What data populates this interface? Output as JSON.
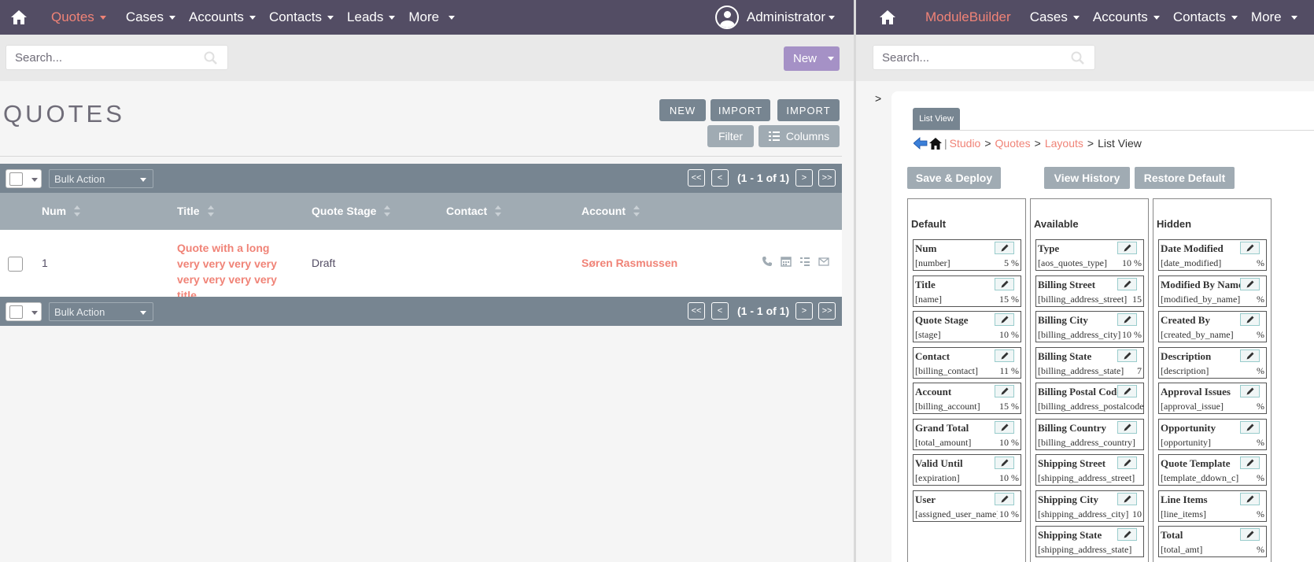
{
  "left": {
    "nav": {
      "items": [
        {
          "label": "Quotes"
        },
        {
          "label": "Cases"
        },
        {
          "label": "Accounts"
        },
        {
          "label": "Contacts"
        },
        {
          "label": "Leads"
        },
        {
          "label": "More"
        }
      ],
      "user": "Administrator"
    },
    "search": {
      "placeholder": "Search..."
    },
    "new_button": "New",
    "page_title": "QUOTES",
    "actions": {
      "new": "NEW",
      "import1": "IMPORT",
      "import2": "IMPORT",
      "filter": "Filter",
      "columns": "Columns"
    },
    "bulk_action": "Bulk Action",
    "pagination": {
      "first": "<<",
      "prev": "<",
      "range": "(1 - 1 of 1)",
      "next": ">",
      "last": ">>"
    },
    "table": {
      "columns": [
        "Num",
        "Title",
        "Quote Stage",
        "Contact",
        "Account"
      ],
      "rows": [
        {
          "num": "1",
          "title": "Quote with a long very very very very very very very very title",
          "stage": "Draft",
          "contact": "",
          "account": "Søren Rasmussen"
        }
      ]
    }
  },
  "right": {
    "nav": {
      "items": [
        {
          "label": "ModuleBuilder"
        },
        {
          "label": "Cases"
        },
        {
          "label": "Accounts"
        },
        {
          "label": "Contacts"
        },
        {
          "label": "More"
        }
      ]
    },
    "search": {
      "placeholder": "Search..."
    },
    "collapse": ">",
    "tab": "List View",
    "breadcrumb": {
      "sep": "|",
      "studio": "Studio",
      "module": "Quotes",
      "layouts": "Layouts",
      "current": "List View",
      "gt": ">"
    },
    "buttons": {
      "save": "Save & Deploy",
      "history": "View History",
      "restore": "Restore Default"
    },
    "columns": {
      "default": {
        "title": "Default",
        "fields": [
          {
            "name": "Num",
            "key": "[number]",
            "width": "5 %"
          },
          {
            "name": "Title",
            "key": "[name]",
            "width": "15 %"
          },
          {
            "name": "Quote Stage",
            "key": "[stage]",
            "width": "10 %"
          },
          {
            "name": "Contact",
            "key": "[billing_contact]",
            "width": "11 %"
          },
          {
            "name": "Account",
            "key": "[billing_account]",
            "width": "15 %"
          },
          {
            "name": "Grand Total",
            "key": "[total_amount]",
            "width": "10 %"
          },
          {
            "name": "Valid Until",
            "key": "[expiration]",
            "width": "10 %"
          },
          {
            "name": "User",
            "key": "[assigned_user_name]",
            "width": "10 %"
          }
        ]
      },
      "available": {
        "title": "Available",
        "fields": [
          {
            "name": "Type",
            "key": "[aos_quotes_type]",
            "width": "10 %"
          },
          {
            "name": "Billing Street",
            "key": "[billing_address_street]",
            "width": "15"
          },
          {
            "name": "Billing City",
            "key": "[billing_address_city]",
            "width": "10 %"
          },
          {
            "name": "Billing State",
            "key": "[billing_address_state]",
            "width": "7"
          },
          {
            "name": "Billing Postal Code",
            "key": "[billing_address_postalcode]",
            "width": ""
          },
          {
            "name": "Billing Country",
            "key": "[billing_address_country]",
            "width": ""
          },
          {
            "name": "Shipping Street",
            "key": "[shipping_address_street]",
            "width": ""
          },
          {
            "name": "Shipping City",
            "key": "[shipping_address_city]",
            "width": "10"
          },
          {
            "name": "Shipping State",
            "key": "[shipping_address_state]",
            "width": ""
          }
        ]
      },
      "hidden": {
        "title": "Hidden",
        "fields": [
          {
            "name": "Date Modified",
            "key": "[date_modified]",
            "width": "%"
          },
          {
            "name": "Modified By Name",
            "key": "[modified_by_name]",
            "width": "%"
          },
          {
            "name": "Created By",
            "key": "[created_by_name]",
            "width": "%"
          },
          {
            "name": "Description",
            "key": "[description]",
            "width": "%"
          },
          {
            "name": "Approval Issues",
            "key": "[approval_issue]",
            "width": "%"
          },
          {
            "name": "Opportunity",
            "key": "[opportunity]",
            "width": "%"
          },
          {
            "name": "Quote Template",
            "key": "[template_ddown_c]",
            "width": "%"
          },
          {
            "name": "Line Items",
            "key": "[line_items]",
            "width": "%"
          },
          {
            "name": "Total",
            "key": "[total_amt]",
            "width": "%"
          }
        ]
      }
    }
  },
  "colors": {
    "nav_bg": "#534d64",
    "accent": "#f08377",
    "toolbar": "#778591",
    "header": "#a0abb3",
    "new_button": "#a591c6"
  }
}
